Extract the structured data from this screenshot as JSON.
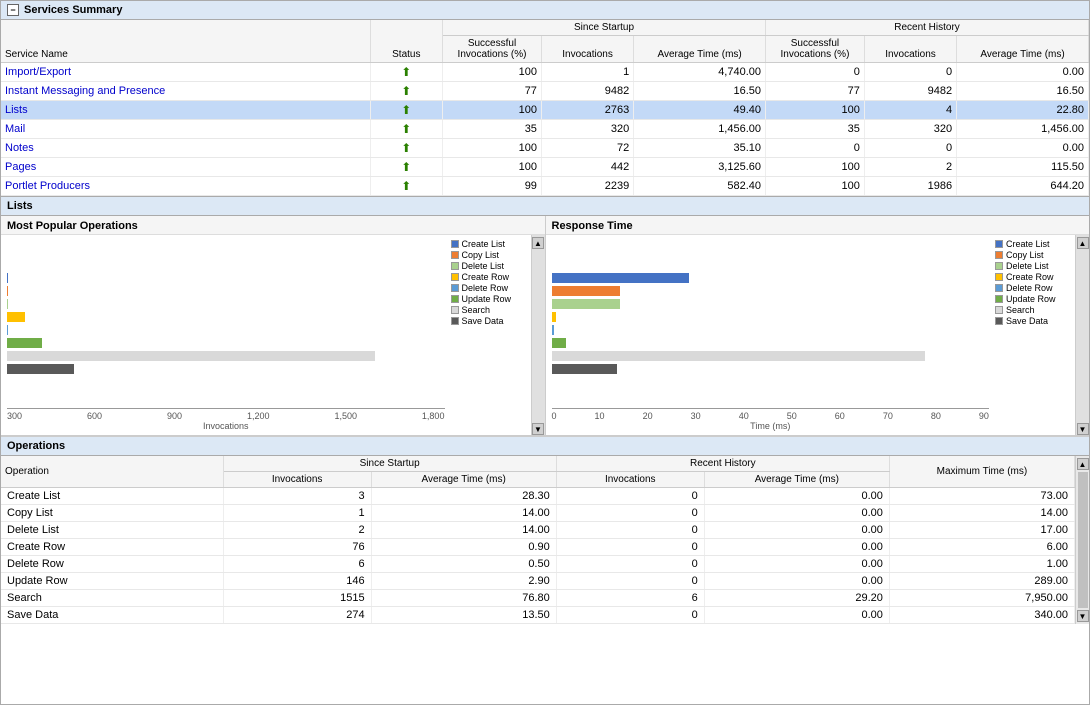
{
  "services_summary": {
    "title": "Services Summary",
    "columns": {
      "service_name": "Service Name",
      "status": "Status",
      "since_startup": "Since Startup",
      "recent_history": "Recent History",
      "successful_invocations": "Successful Invocations (%)",
      "invocations": "Invocations",
      "average_time": "Average Time (ms)"
    },
    "rows": [
      {
        "name": "Import/Export",
        "status": "up",
        "ss_pct": "100",
        "ss_inv": "1",
        "ss_avg": "4,740.00",
        "rh_pct": "0",
        "rh_inv": "0",
        "rh_avg": "0.00",
        "selected": false,
        "link": true
      },
      {
        "name": "Instant Messaging and Presence",
        "status": "up",
        "ss_pct": "77",
        "ss_inv": "9482",
        "ss_avg": "16.50",
        "rh_pct": "77",
        "rh_inv": "9482",
        "rh_avg": "16.50",
        "selected": false,
        "link": true
      },
      {
        "name": "Lists",
        "status": "up",
        "ss_pct": "100",
        "ss_inv": "2763",
        "ss_avg": "49.40",
        "rh_pct": "100",
        "rh_inv": "4",
        "rh_avg": "22.80",
        "selected": true,
        "link": true
      },
      {
        "name": "Mail",
        "status": "up",
        "ss_pct": "35",
        "ss_inv": "320",
        "ss_avg": "1,456.00",
        "rh_pct": "35",
        "rh_inv": "320",
        "rh_avg": "1,456.00",
        "selected": false,
        "link": true
      },
      {
        "name": "Notes",
        "status": "up",
        "ss_pct": "100",
        "ss_inv": "72",
        "ss_avg": "35.10",
        "rh_pct": "0",
        "rh_inv": "0",
        "rh_avg": "0.00",
        "selected": false,
        "link": true
      },
      {
        "name": "Pages",
        "status": "up",
        "ss_pct": "100",
        "ss_inv": "442",
        "ss_avg": "3,125.60",
        "rh_pct": "100",
        "rh_inv": "2",
        "rh_avg": "115.50",
        "selected": false,
        "link": true
      },
      {
        "name": "Portlet Producers",
        "status": "up",
        "ss_pct": "99",
        "ss_inv": "2239",
        "ss_avg": "582.40",
        "rh_pct": "100",
        "rh_inv": "1986",
        "rh_avg": "644.20",
        "selected": false,
        "link": true
      }
    ]
  },
  "lists_section": {
    "title": "Lists",
    "charts": {
      "popular_ops": {
        "title": "Most Popular Operations",
        "x_label": "Invocations",
        "x_ticks": [
          "300",
          "600",
          "900",
          "1,200",
          "1,500",
          "1,800"
        ],
        "bars": [
          {
            "label": "Create List",
            "color": "#4472c4",
            "value": 3,
            "max": 1800
          },
          {
            "label": "Copy List",
            "color": "#ed7d31",
            "value": 1,
            "max": 1800
          },
          {
            "label": "Delete List",
            "color": "#a9d18e",
            "value": 2,
            "max": 1800
          },
          {
            "label": "Create Row",
            "color": "#ffc000",
            "value": 76,
            "max": 1800
          },
          {
            "label": "Delete Row",
            "color": "#5b9bd5",
            "value": 6,
            "max": 1800
          },
          {
            "label": "Update Row",
            "color": "#70ad47",
            "value": 146,
            "max": 1800
          },
          {
            "label": "Search",
            "color": "#d9d9d9",
            "value": 1515,
            "max": 1800
          },
          {
            "label": "Save Data",
            "color": "#595959",
            "value": 274,
            "max": 1800
          }
        ]
      },
      "response_time": {
        "title": "Response Time",
        "x_label": "Time (ms)",
        "x_ticks": [
          "0",
          "10",
          "20",
          "30",
          "40",
          "50",
          "60",
          "70",
          "80",
          "90"
        ],
        "bars": [
          {
            "label": "Create List",
            "color": "#4472c4",
            "value": 28.3,
            "max": 90
          },
          {
            "label": "Copy List",
            "color": "#ed7d31",
            "value": 14,
            "max": 90
          },
          {
            "label": "Delete List",
            "color": "#a9d18e",
            "value": 14,
            "max": 90
          },
          {
            "label": "Create Row",
            "color": "#ffc000",
            "value": 0.9,
            "max": 90
          },
          {
            "label": "Delete Row",
            "color": "#5b9bd5",
            "value": 0.5,
            "max": 90
          },
          {
            "label": "Update Row",
            "color": "#70ad47",
            "value": 2.9,
            "max": 90
          },
          {
            "label": "Search",
            "color": "#d9d9d9",
            "value": 76.8,
            "max": 90
          },
          {
            "label": "Save Data",
            "color": "#595959",
            "value": 13.5,
            "max": 90
          }
        ]
      }
    }
  },
  "operations": {
    "title": "Operations",
    "col_operation": "Operation",
    "col_since_startup": "Since Startup",
    "col_recent_history": "Recent History",
    "col_max_time": "Maximum Time (ms)",
    "col_invocations": "Invocations",
    "col_avg_time": "Average Time (ms)",
    "rows": [
      {
        "operation": "Create List",
        "ss_inv": "3",
        "ss_avg": "28.30",
        "rh_inv": "0",
        "rh_avg": "0.00",
        "max_time": "73.00"
      },
      {
        "operation": "Copy List",
        "ss_inv": "1",
        "ss_avg": "14.00",
        "rh_inv": "0",
        "rh_avg": "0.00",
        "max_time": "14.00"
      },
      {
        "operation": "Delete List",
        "ss_inv": "2",
        "ss_avg": "14.00",
        "rh_inv": "0",
        "rh_avg": "0.00",
        "max_time": "17.00"
      },
      {
        "operation": "Create Row",
        "ss_inv": "76",
        "ss_avg": "0.90",
        "rh_inv": "0",
        "rh_avg": "0.00",
        "max_time": "6.00"
      },
      {
        "operation": "Delete Row",
        "ss_inv": "6",
        "ss_avg": "0.50",
        "rh_inv": "0",
        "rh_avg": "0.00",
        "max_time": "1.00"
      },
      {
        "operation": "Update Row",
        "ss_inv": "146",
        "ss_avg": "2.90",
        "rh_inv": "0",
        "rh_avg": "0.00",
        "max_time": "289.00"
      },
      {
        "operation": "Search",
        "ss_inv": "1515",
        "ss_avg": "76.80",
        "rh_inv": "6",
        "rh_avg": "29.20",
        "max_time": "7,950.00"
      },
      {
        "operation": "Save Data",
        "ss_inv": "274",
        "ss_avg": "13.50",
        "rh_inv": "0",
        "rh_avg": "0.00",
        "max_time": "340.00"
      }
    ]
  },
  "ui": {
    "collapse_icon": "−",
    "arrow_up": "⬆",
    "scroll_up": "▲",
    "scroll_down": "▼"
  }
}
